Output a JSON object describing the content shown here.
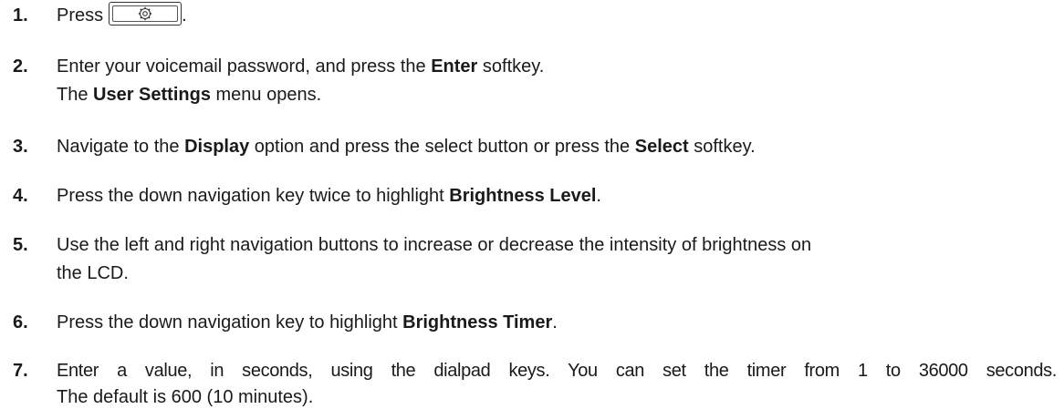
{
  "steps": [
    {
      "num": "1.",
      "before": "Press",
      "key_icon": "settings-gear-icon",
      "after": "."
    },
    {
      "num": "2.",
      "l1a": "Enter your voicemail password, and press the ",
      "l1b": "Enter",
      "l1c": " softkey.",
      "l2a": "The ",
      "l2b": "User Settings",
      "l2c": " menu opens."
    },
    {
      "num": "3.",
      "a": "Navigate to the ",
      "b": "Display",
      "c": " option and press the select button or press the ",
      "d": "Select",
      "e": " softkey."
    },
    {
      "num": "4.",
      "a": "Press the down navigation key twice to highlight ",
      "b": "Brightness Level",
      "c": "."
    },
    {
      "num": "5.",
      "l1": "Use the left and right navigation buttons to increase or decrease the intensity of brightness on",
      "l2": "the LCD."
    },
    {
      "num": "6.",
      "a": "Press the down navigation key to highlight ",
      "b": "Brightness Timer",
      "c": "."
    },
    {
      "num": "7.",
      "l1": "Enter a value, in seconds, using the dialpad keys. You can set the timer from 1 to 36000 seconds.",
      "l2": "The default is 600 (10 minutes)."
    }
  ]
}
